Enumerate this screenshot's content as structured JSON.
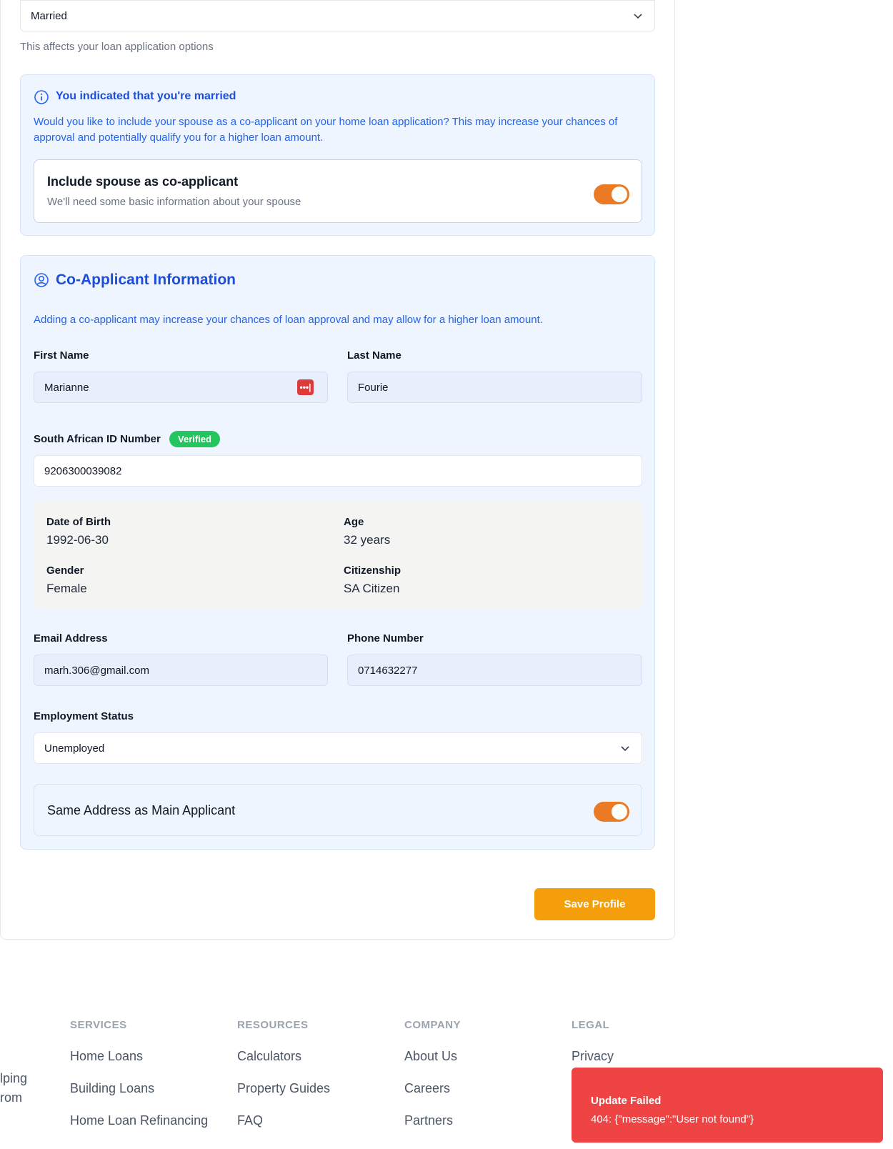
{
  "marital": {
    "selected": "Married",
    "helper": "This affects your loan application options"
  },
  "notice": {
    "title": "You indicated that you're married",
    "body": "Would you like to include your spouse as a co-applicant on your home loan application? This may increase your chances of approval and potentially qualify you for a higher loan amount.",
    "option_title": "Include spouse as co-applicant",
    "option_sub": "We'll need some basic information about your spouse",
    "option_on": true
  },
  "coapp": {
    "title": "Co-Applicant Information",
    "intro": "Adding a co-applicant may increase your chances of loan approval and may allow for a higher loan amount.",
    "first_name_label": "First Name",
    "first_name": "Marianne",
    "last_name_label": "Last Name",
    "last_name": "Fourie",
    "id_label": "South African ID Number",
    "id_badge": "Verified",
    "id_number": "9206300039082",
    "dob_label": "Date of Birth",
    "dob": "1992-06-30",
    "age_label": "Age",
    "age": "32 years",
    "gender_label": "Gender",
    "gender": "Female",
    "citizenship_label": "Citizenship",
    "citizenship": "SA Citizen",
    "email_label": "Email Address",
    "email": "marh.306@gmail.com",
    "phone_label": "Phone Number",
    "phone": "0714632277",
    "employment_label": "Employment Status",
    "employment": "Unemployed",
    "same_address_label": "Same Address as Main Applicant",
    "same_address_on": true
  },
  "actions": {
    "save": "Save Profile"
  },
  "footer": {
    "left_fragment_1": "lping",
    "left_fragment_2": "rom",
    "columns": [
      {
        "heading": "SERVICES",
        "links": [
          "Home Loans",
          "Building Loans",
          "Home Loan Refinancing"
        ]
      },
      {
        "heading": "RESOURCES",
        "links": [
          "Calculators",
          "Property Guides",
          "FAQ"
        ]
      },
      {
        "heading": "COMPANY",
        "links": [
          "About Us",
          "Careers",
          "Partners"
        ]
      },
      {
        "heading": "LEGAL",
        "links": [
          "Privacy"
        ]
      }
    ]
  },
  "toast": {
    "title": "Update Failed",
    "message": "404: {\"message\":\"User not found\"}"
  },
  "colors": {
    "accent_orange": "#ea7a24",
    "save_button": "#f59e0b",
    "verified": "#22c55e",
    "error": "#ef4444",
    "info_blue": "#2563eb"
  }
}
